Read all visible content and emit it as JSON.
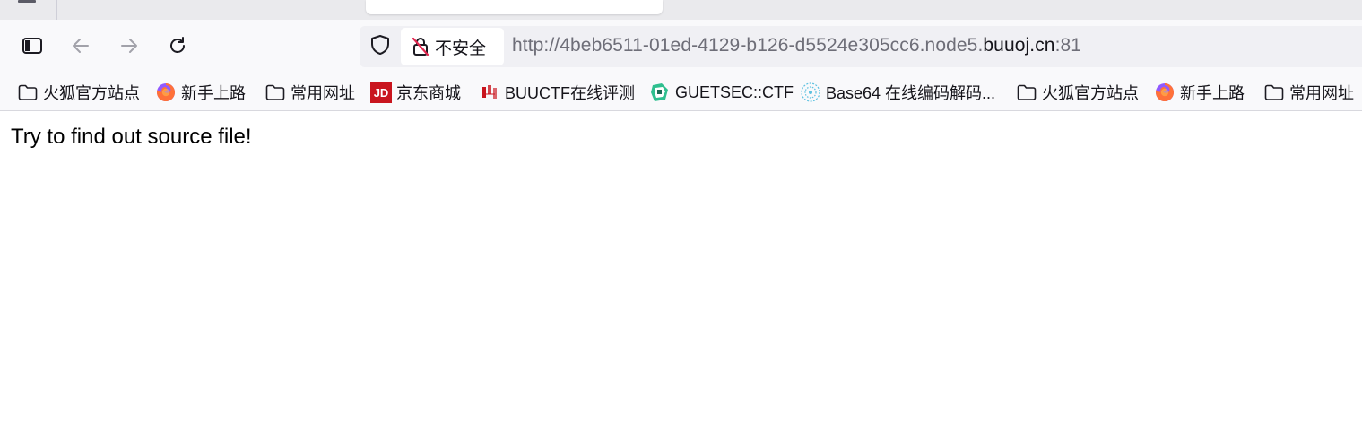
{
  "browser": {
    "nav": {
      "sidebar_icon": "sidebar-icon",
      "back_icon": "arrow-left-icon",
      "forward_icon": "arrow-right-icon",
      "reload_icon": "reload-icon"
    },
    "urlbar": {
      "security_label": "不安全",
      "url_prefix": "http://4beb6511-01ed-4129-b126-d5524e305cc6.node5.",
      "url_host": "buuoj.cn",
      "url_suffix": ":81"
    },
    "bookmarks": [
      {
        "label": "火狐官方站点",
        "icon": "folder-icon"
      },
      {
        "label": "新手上路",
        "icon": "firefox-icon"
      },
      {
        "label": "常用网址",
        "icon": "folder-icon"
      },
      {
        "label": "京东商城",
        "icon": "jd-icon"
      },
      {
        "label": "BUUCTF在线评测",
        "icon": "buuctf-icon"
      },
      {
        "label": "GUETSEC::CTF",
        "icon": "guetsec-icon"
      },
      {
        "label": "Base64 在线编码解码...",
        "icon": "base64-icon"
      },
      {
        "label": "火狐官方站点",
        "icon": "folder-icon"
      },
      {
        "label": "新手上路",
        "icon": "firefox-icon"
      },
      {
        "label": "常用网址",
        "icon": "folder-icon"
      }
    ]
  },
  "page": {
    "message": "Try to find out source file!"
  },
  "colors": {
    "toolbar_bg": "#f9f9fb",
    "urlbar_bg": "#f0f0f4",
    "tabstrip_bg": "#eaeaed",
    "jd_red": "#c9151e",
    "firefox_orange": "#ff7139",
    "firefox_purple": "#9059ff"
  }
}
